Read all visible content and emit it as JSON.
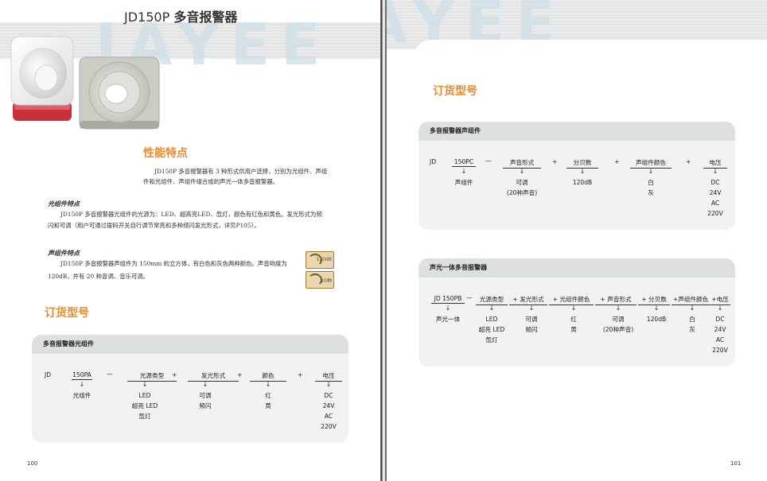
{
  "left": {
    "title_code": "JD150P",
    "title_name": "多音报警器",
    "watermark": "JAYEE",
    "features_heading": "性能特点",
    "features_text_1": "JD150P 多音报警器有 3 种形式供用户选择，分别为光组件、声组",
    "features_text_2": "件和光组件、声组件组合成的声光一体多音报警器。",
    "light_heading": "光组件特点",
    "light_text_1": "JD150P 多音报警器光组件的光源为：LED、超高亮LED、氙灯，颜色有红色和黄色。发光形式为频",
    "light_text_2": "闪和可调（用户可通过拨码开关自行调节常亮和多种频闪发光形式，详见P105）。",
    "sound_heading": "声组件特点",
    "sound_text_1": "JD150P 多音报警器声组件为 150mm 的立方体，有白色和灰色两种颜色。声音响度为",
    "sound_text_2": "120dB，并有 20 种音调、音乐可调。",
    "badge_1": "120dB",
    "badge_2": "20种",
    "order_heading": "订货型号",
    "card_title": "多音报警器光组件",
    "code": {
      "prefix": "JD",
      "model": "150PA",
      "dash": "—",
      "f1": "光源类型",
      "plus1": "+",
      "f2": "发光形式",
      "plus2": "+",
      "f3": "颜色",
      "plus3": "+",
      "f4": "电压"
    },
    "arrow": "↓",
    "values": {
      "model": "光组件",
      "f1": [
        "LED",
        "超亮 LED",
        "氙灯"
      ],
      "f2": [
        "可调",
        "频闪"
      ],
      "f3": [
        "红",
        "黄"
      ],
      "f4": [
        "DC",
        "24V",
        "AC",
        "220V"
      ]
    },
    "page_number": "100"
  },
  "right": {
    "watermark": "AYEE",
    "order_heading": "订货型号",
    "card1_title": "多音报警器声组件",
    "card1_code": {
      "prefix": "JD",
      "model": "150PC",
      "dash": "—",
      "f1": "声音形式",
      "plus1": "+",
      "f2": "分贝数",
      "plus2": "+",
      "f3": "声组件颜色",
      "plus3": "+",
      "f4": "电压"
    },
    "card1_values": {
      "model": "声组件",
      "f1": [
        "可调",
        "(20种声音)"
      ],
      "f2": [
        "120dB"
      ],
      "f3": [
        "白",
        "灰"
      ],
      "f4": [
        "DC",
        "24V",
        "AC",
        "220V"
      ]
    },
    "card2_title": "声光一体多音报警器",
    "card2_code": {
      "prefix": "JD 150PB",
      "dash": "—",
      "f1": "光源类型",
      "f2": "+ 发光形式",
      "f3": "+ 光组件颜色",
      "f4": "+ 声音形式",
      "f5": "+ 分贝数",
      "f6": "+声组件颜色",
      "f7": "+电压"
    },
    "card2_values": {
      "model": "声光一体",
      "f1": [
        "LED",
        "超亮 LED",
        "氙灯"
      ],
      "f2": [
        "可调",
        "频闪"
      ],
      "f3": [
        "红",
        "黄"
      ],
      "f4": [
        "可调",
        "(20种声音)"
      ],
      "f5": [
        "120dB"
      ],
      "f6": [
        "白",
        "灰"
      ],
      "f7": [
        "DC",
        "24V",
        "AC",
        "220V"
      ]
    },
    "page_number": "101"
  },
  "colors": {
    "accent": "#ec8a2e",
    "card_bg": "#f1f2f2",
    "card_head": "#dde0e1"
  }
}
